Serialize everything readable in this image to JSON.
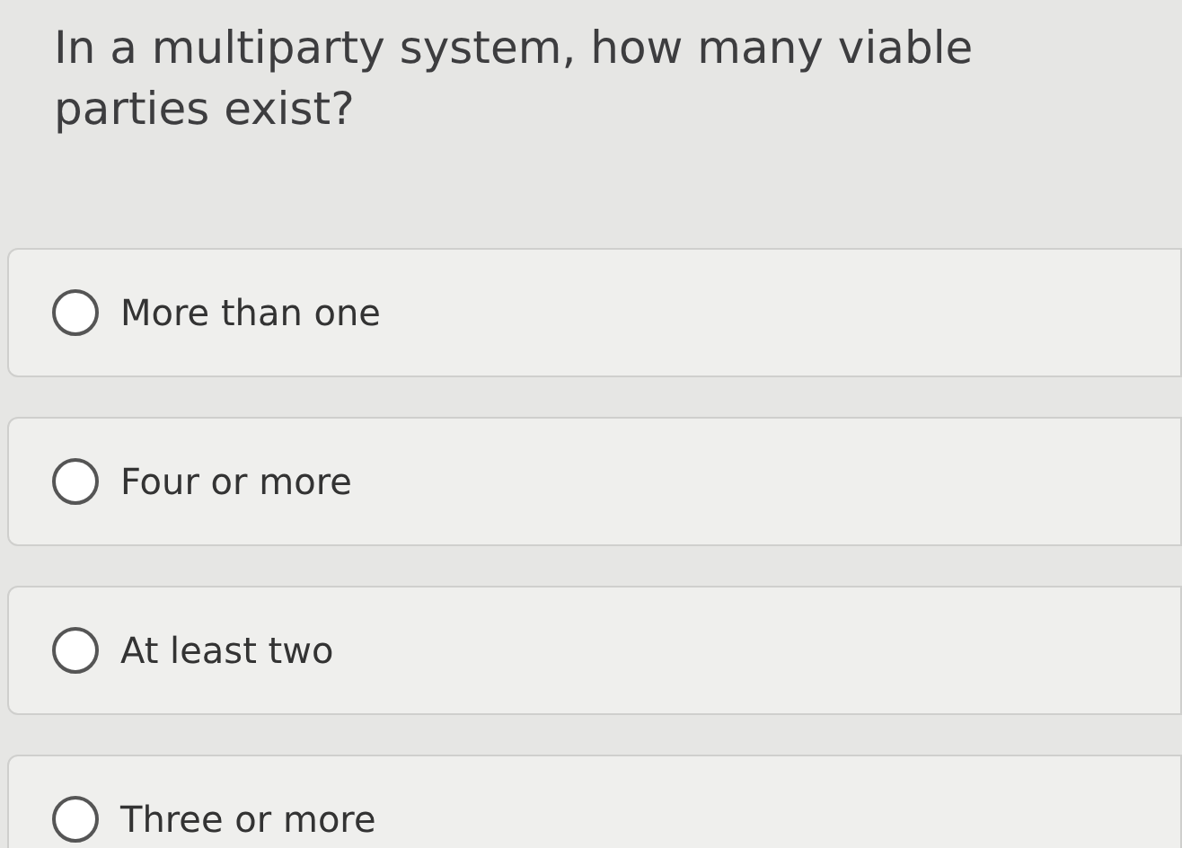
{
  "question": "In a multiparty system, how many viable parties exist?",
  "options": [
    {
      "label": "More than one",
      "selected": false
    },
    {
      "label": "Four or more",
      "selected": false
    },
    {
      "label": "At least two",
      "selected": false
    },
    {
      "label": "Three or more",
      "selected": false
    }
  ]
}
